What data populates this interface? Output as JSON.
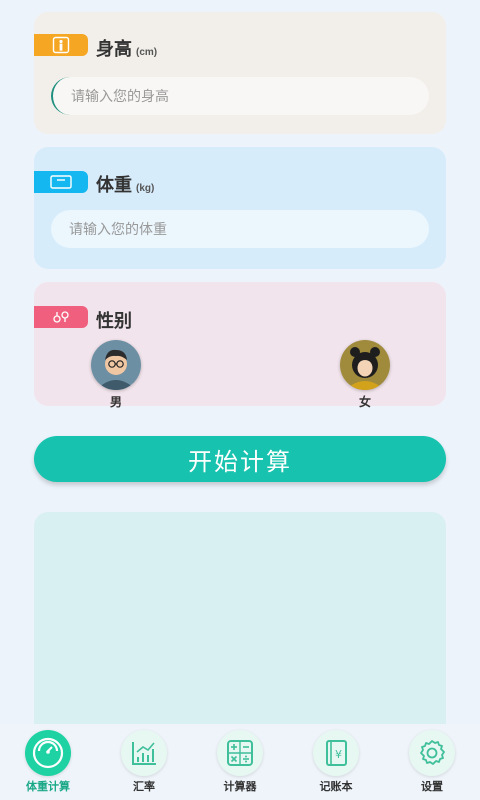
{
  "height_card": {
    "title": "身高",
    "unit": "(cm)",
    "placeholder": "请输入您的身高",
    "accent": "#f5a623"
  },
  "weight_card": {
    "title": "体重",
    "unit": "(kg)",
    "placeholder": "请输入您的体重",
    "accent": "#14b7f0"
  },
  "gender_card": {
    "title": "性别",
    "accent": "#f0607e",
    "options": [
      {
        "label": "男",
        "icon": "male-avatar"
      },
      {
        "label": "女",
        "icon": "female-avatar"
      }
    ]
  },
  "calculate_button": {
    "label": "开始计算",
    "color": "#17c3ae"
  },
  "tabbar": {
    "items": [
      {
        "label": "体重计算",
        "icon": "scale-icon",
        "active": true
      },
      {
        "label": "汇率",
        "icon": "chart-icon",
        "active": false
      },
      {
        "label": "计算器",
        "icon": "calculator-icon",
        "active": false
      },
      {
        "label": "记账本",
        "icon": "ledger-icon",
        "active": false
      },
      {
        "label": "设置",
        "icon": "gear-icon",
        "active": false
      }
    ],
    "active_color": "#1aa887"
  }
}
